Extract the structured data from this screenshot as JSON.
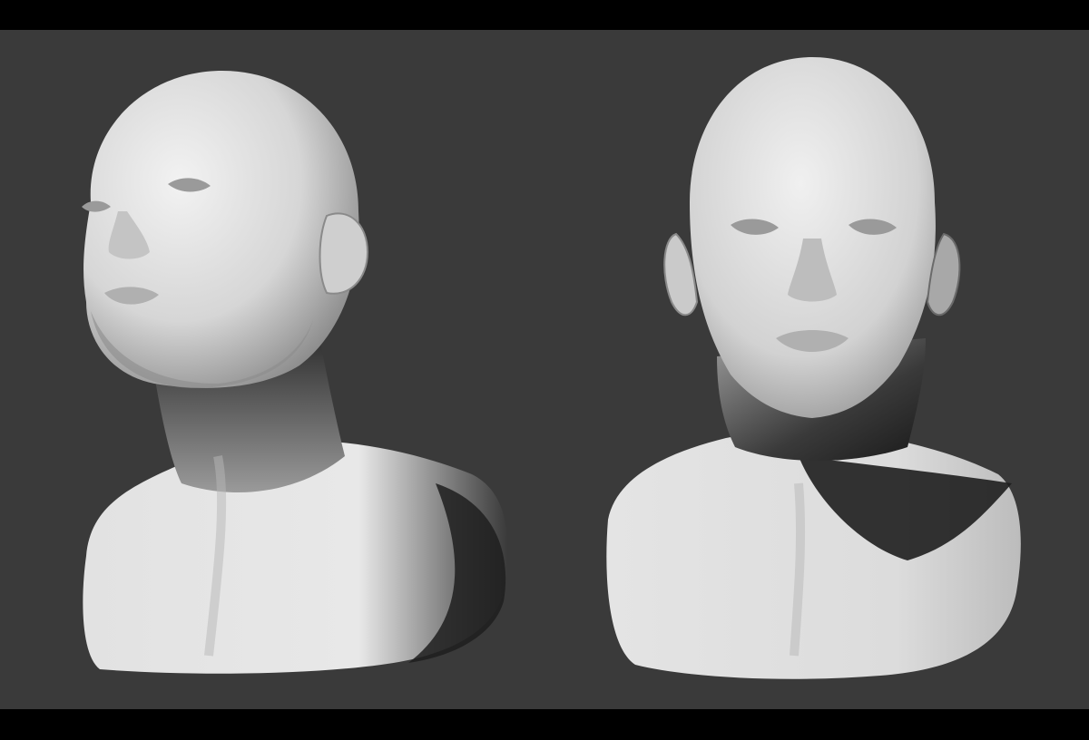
{
  "scene": {
    "description_visible_text": "",
    "background_color": "#3a3a3a",
    "letterbox_color": "#000000",
    "sculpt_color": "#e6e6e6",
    "shadow_color": "#1a1a1a",
    "models": [
      {
        "view": "three-quarter-left-upward"
      },
      {
        "view": "front"
      }
    ]
  }
}
